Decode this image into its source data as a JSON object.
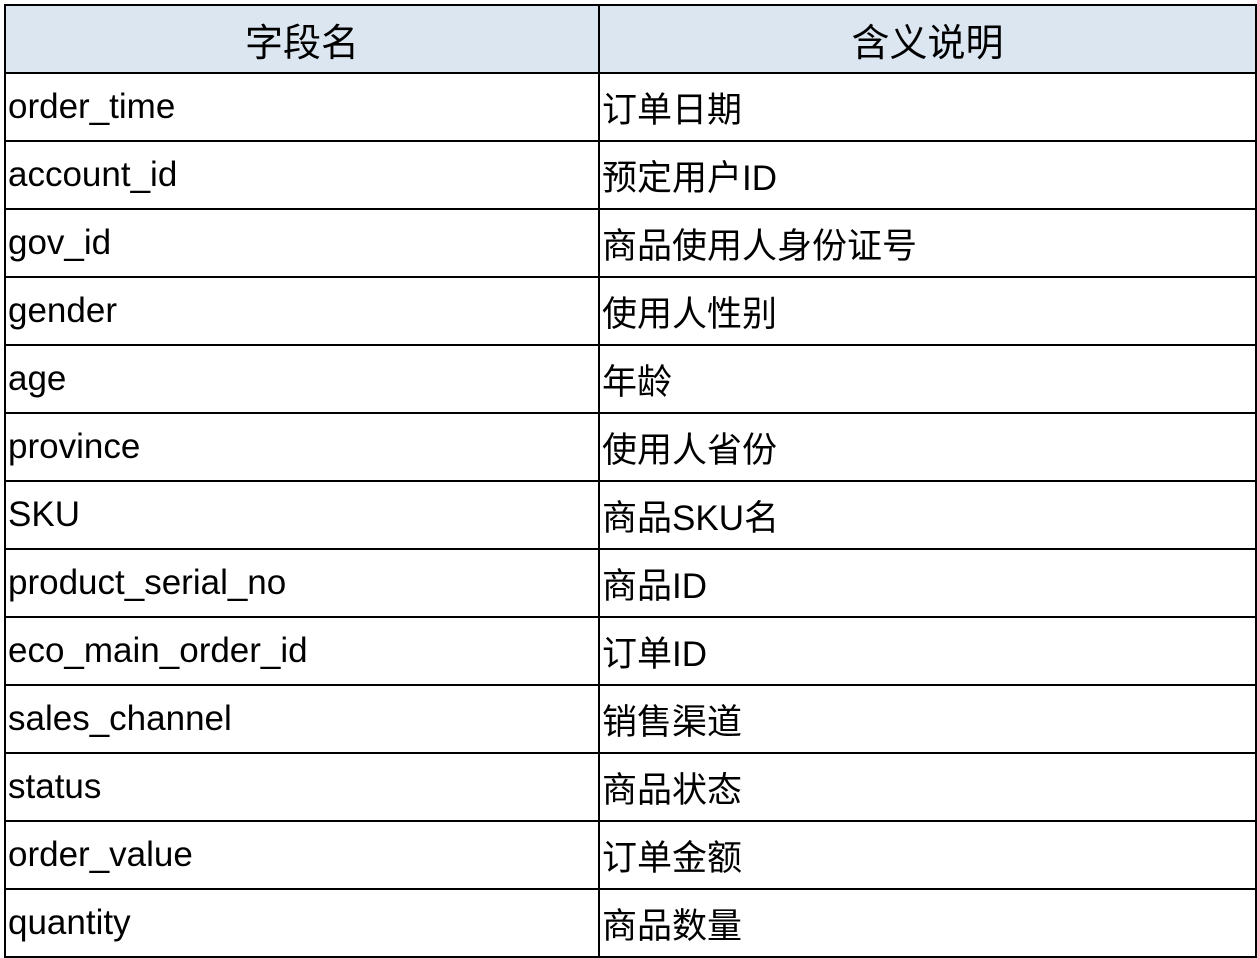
{
  "table": {
    "headers": [
      "字段名",
      "含义说明"
    ],
    "rows": [
      [
        "order_time",
        "订单日期"
      ],
      [
        "account_id",
        "预定用户ID"
      ],
      [
        "gov_id",
        "商品使用人身份证号"
      ],
      [
        "gender",
        "使用人性别"
      ],
      [
        "age",
        "年龄"
      ],
      [
        "province",
        "使用人省份"
      ],
      [
        "SKU",
        "商品SKU名"
      ],
      [
        "product_serial_no",
        "商品ID"
      ],
      [
        "eco_main_order_id",
        "订单ID"
      ],
      [
        "sales_channel",
        "销售渠道"
      ],
      [
        "status",
        "商品状态"
      ],
      [
        "order_value",
        "订单金额"
      ],
      [
        "quantity",
        "商品数量"
      ]
    ]
  },
  "colors": {
    "header_background": "#dce6f1",
    "border": "#000000",
    "text": "#000000"
  }
}
